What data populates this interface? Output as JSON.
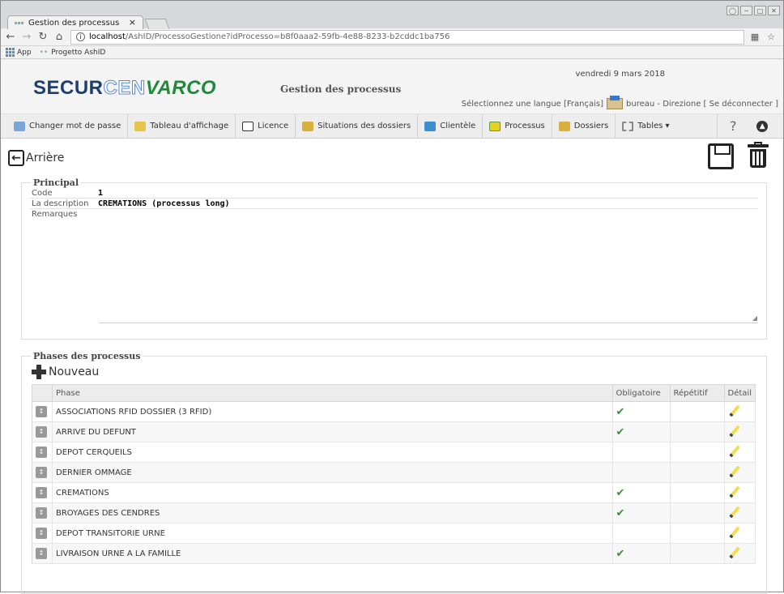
{
  "browser": {
    "tab_title": "Gestion des processus",
    "tab_close": "×",
    "url_host": "localhost",
    "url_path": "/AshID/ProcessoGestione?idProcesso=b8f0aaa2-59fb-4e88-8233-b2cddc1ba756",
    "bookmarks": [
      "App",
      "Progetto AshID"
    ]
  },
  "header": {
    "logo_part1": "SECUR",
    "logo_part2": "CEN",
    "logo_part3": "VARCO",
    "title": "Gestion des processus",
    "date": "vendredi 9 mars 2018",
    "language_text": "Sélectionnez une langue [Français]",
    "user_text": "bureau - Direzione [ Se déconnecter ]"
  },
  "toolbar": {
    "items": [
      {
        "label": "Changer mot de passe",
        "icon": "user-key-icon"
      },
      {
        "label": "Tableau d'affichage",
        "icon": "folder-icon"
      },
      {
        "label": "Licence",
        "icon": "document-icon"
      },
      {
        "label": "Situations des dossiers",
        "icon": "folder-chart-icon"
      },
      {
        "label": "Clientèle",
        "icon": "client-icon"
      },
      {
        "label": "Processus",
        "icon": "process-icon"
      },
      {
        "label": "Dossiers",
        "icon": "folder-icon"
      },
      {
        "label": "Tables ▾",
        "icon": "gear-icon"
      }
    ],
    "help": "?"
  },
  "actions": {
    "back_label": "Arrière"
  },
  "principal": {
    "legend": "Principal",
    "code_label": "Code",
    "code_value": "1",
    "description_label": "La description",
    "description_value": "CREMATIONS (processus long)",
    "remarks_label": "Remarques",
    "remarks_value": ""
  },
  "phases": {
    "legend": "Phases des processus",
    "new_label": "Nouveau",
    "columns": [
      "Phase",
      "Obligatoire",
      "Répétitif",
      "Détail"
    ],
    "check_glyph": "✔",
    "rows": [
      {
        "phase": "ASSOCIATIONS RFID DOSSIER (3 RFID)",
        "obligatoire": true,
        "repetitif": false
      },
      {
        "phase": "ARRIVE DU DEFUNT",
        "obligatoire": true,
        "repetitif": false
      },
      {
        "phase": "DEPOT CERQUEILS",
        "obligatoire": false,
        "repetitif": false
      },
      {
        "phase": "DERNIER OMMAGE",
        "obligatoire": false,
        "repetitif": false
      },
      {
        "phase": "CREMATIONS",
        "obligatoire": true,
        "repetitif": false
      },
      {
        "phase": "BROYAGES DES CENDRES",
        "obligatoire": true,
        "repetitif": false
      },
      {
        "phase": "DEPOT TRANSITORIE URNE",
        "obligatoire": false,
        "repetitif": false
      },
      {
        "phase": "LIVRAISON URNE A LA FAMILLE",
        "obligatoire": true,
        "repetitif": false
      }
    ]
  },
  "colors": {
    "logo_blue": "#1d3e6e",
    "logo_green": "#1d8a3a",
    "check_green": "#3e8a3e"
  }
}
